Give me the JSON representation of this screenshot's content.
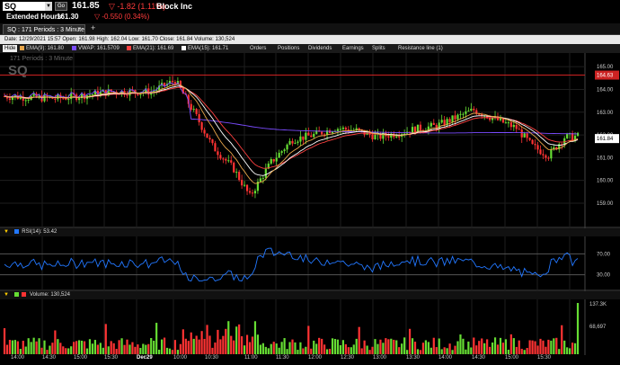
{
  "header": {
    "symbol": "SQ",
    "go_label": "Go",
    "last_price": "161.85",
    "change": "-1.82 (1.11%)",
    "company": "Block Inc",
    "ext_label": "Extended Hours:",
    "ext_price": "161.30",
    "ext_change": "-0.550 (0.34%)"
  },
  "tab": {
    "label": "SQ : 171  Periods : 3 Minute",
    "close": "×",
    "add": "+"
  },
  "info_bar": "Date: 12/29/2021 15:57   Open: 161.98   High: 162.04   Low: 161.70   Close: 161.84   Volume: 130,524",
  "legend": {
    "hide": "Hide",
    "items": [
      {
        "label": "EMA(9): 161.80",
        "color": "#e8a64a"
      },
      {
        "label": "VWAP: 161.5709",
        "color": "#7b4cff"
      },
      {
        "label": "EMA(21): 161.69",
        "color": "#ff4040"
      },
      {
        "label": "EMA(15): 161.71",
        "color": "#ffffff"
      },
      {
        "label": "Orders",
        "color": ""
      },
      {
        "label": "Positions",
        "color": ""
      },
      {
        "label": "Dividends",
        "color": ""
      },
      {
        "label": "Earnings",
        "color": ""
      },
      {
        "label": "Splits",
        "color": ""
      },
      {
        "label": "Resistance line (1)",
        "color": ""
      }
    ]
  },
  "watermark": {
    "line1": "171  Periods : 3 Minute",
    "symbol": "SQ"
  },
  "price_axis": [
    "165.00",
    "164.00",
    "163.00",
    "162.00",
    "161.00",
    "160.00",
    "159.00"
  ],
  "resistance_label": "164.63",
  "last_label": "161.84",
  "rsi": {
    "label": "RSI(14): 53.42",
    "levels": [
      "70.00",
      "30.00"
    ],
    "color": "#2277ff"
  },
  "volume": {
    "label": "Volume: 130,524",
    "axis": [
      "137.3K",
      "68,697"
    ]
  },
  "x_axis": [
    "14:00",
    "14:30",
    "15:00",
    "15:30",
    "Dec29",
    "10:00",
    "10:30",
    "11:00",
    "11:30",
    "12:00",
    "12:30",
    "13:00",
    "13:30",
    "14:00",
    "14:30",
    "15:00",
    "15:30"
  ],
  "colors": {
    "up": "#66dd33",
    "down": "#ff3333",
    "resistance": "#cc2222"
  }
}
